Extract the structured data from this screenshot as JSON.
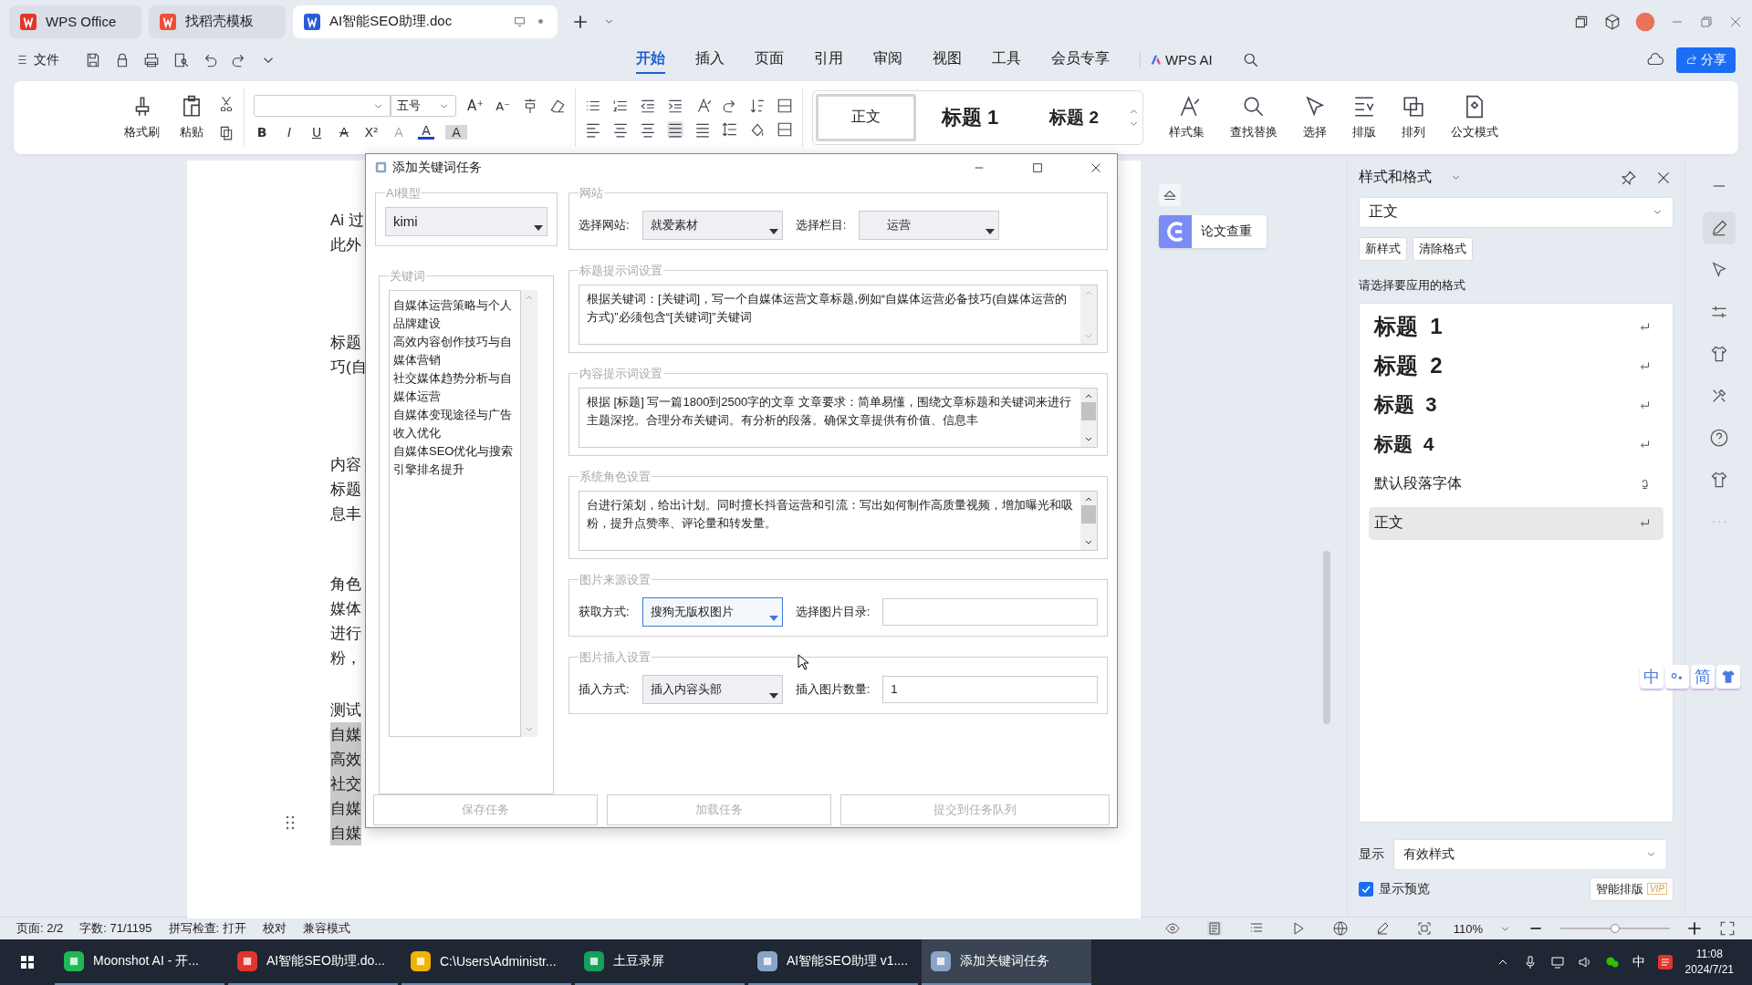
{
  "app_tabs": [
    {
      "label": "WPS Office",
      "kind": "home",
      "selected": false
    },
    {
      "label": "找稻壳模板",
      "kind": "template",
      "selected": false
    },
    {
      "label": "AI智能SEO助理.doc",
      "kind": "doc",
      "selected": true
    }
  ],
  "file_menu": "文件",
  "ribbon_tabs": [
    {
      "label": "开始",
      "selected": true
    },
    {
      "label": "插入",
      "selected": false
    },
    {
      "label": "页面",
      "selected": false
    },
    {
      "label": "引用",
      "selected": false
    },
    {
      "label": "审阅",
      "selected": false
    },
    {
      "label": "视图",
      "selected": false
    },
    {
      "label": "工具",
      "selected": false
    },
    {
      "label": "会员专享",
      "selected": false
    }
  ],
  "wps_ai": "WPS AI",
  "share_button": "分享",
  "ribbon": {
    "format_painter": "格式刷",
    "paste": "粘贴",
    "font_size": "五号",
    "font_top": [
      {
        "label": "A⁺",
        "kind": "grow"
      },
      {
        "label": "A⁻",
        "kind": "shrink"
      }
    ],
    "font_bottom": [
      {
        "label": "B",
        "kind": "bold"
      },
      {
        "label": "I",
        "kind": "italic"
      },
      {
        "label": "U",
        "kind": "underline"
      },
      {
        "label": "A",
        "kind": "strike"
      },
      {
        "label": "X²",
        "kind": "super"
      },
      {
        "label": "A",
        "kind": "effect"
      },
      {
        "label": "A",
        "kind": "color"
      },
      {
        "label": "A",
        "kind": "shade"
      }
    ],
    "style_gallery": [
      {
        "label": "正文",
        "kind": "body",
        "selected": true
      },
      {
        "label": "标题 1",
        "kind": "h1",
        "selected": false
      },
      {
        "label": "标题 2",
        "kind": "h2",
        "selected": false
      }
    ],
    "tools": [
      {
        "label": "样式集",
        "kind": "styleset"
      },
      {
        "label": "查找替换",
        "kind": "find"
      },
      {
        "label": "选择",
        "kind": "select"
      },
      {
        "label": "排版",
        "kind": "layout"
      },
      {
        "label": "排列",
        "kind": "arrange"
      },
      {
        "label": "公文模式",
        "kind": "official"
      }
    ]
  },
  "document": {
    "paragraphs": [
      [
        {
          "text": "Ai 过",
          "highlighted": false
        },
        {
          "text": "此外",
          "highlighted": false
        }
      ],
      [
        {
          "text": "标题",
          "highlighted": false
        },
        {
          "text": "巧(自",
          "highlighted": false
        }
      ],
      [
        {
          "text": "内容",
          "highlighted": false
        },
        {
          "text": "标题",
          "highlighted": false
        },
        {
          "text": "息丰",
          "highlighted": false
        }
      ],
      [
        {
          "text": "角色",
          "highlighted": false
        },
        {
          "text": "媒体",
          "highlighted": false
        },
        {
          "text": "进行",
          "highlighted": false
        },
        {
          "text": "粉，",
          "highlighted": false
        }
      ],
      [
        {
          "text": "测试",
          "highlighted": false
        },
        {
          "text": "自媒",
          "highlighted": true
        },
        {
          "text": "高效",
          "highlighted": true
        },
        {
          "text": "社交",
          "highlighted": true
        },
        {
          "text": "自媒",
          "highlighted": true
        },
        {
          "text": "自媒",
          "highlighted": true
        }
      ]
    ]
  },
  "dialog": {
    "title": "添加关键词任务",
    "model": {
      "legend": "AI模型",
      "value": "kimi"
    },
    "site": {
      "legend": "网站",
      "site_label": "选择网站:",
      "site_value": "就爱素材",
      "column_label": "选择栏目:",
      "column_value": "运营"
    },
    "keywords": {
      "legend": "关键词",
      "items": [
        "自媒体运营策略与个人品牌建设",
        "高效内容创作技巧与自媒体营销",
        "社交媒体趋势分析与自媒体运营",
        "自媒体变现途径与广告收入优化",
        "自媒体SEO优化与搜索引擎排名提升"
      ]
    },
    "prompts": [
      {
        "legend": "标题提示词设置",
        "text": "根据关键词：[关键词]，写一个自媒体运营文章标题,例如“自媒体运营必备技巧(自媒体运营的方式)”必须包含“[关键词]”关键词",
        "scrollable": false
      },
      {
        "legend": "内容提示词设置",
        "text": "根据 [标题] 写一篇1800到2500字的文章 文章要求：简单易懂，围绕文章标题和关键词来进行主题深挖。合理分布关键词。有分析的段落。确保文章提供有价值、信息丰",
        "scrollable": true
      },
      {
        "legend": "系统角色设置",
        "text": "台进行策划，给出计划。同时擅长抖音运营和引流：写出如何制作高质量视频，增加曝光和吸粉，提升点赞率、评论量和转发量。",
        "scrollable": true
      }
    ],
    "image_source": {
      "legend": "图片来源设置",
      "method_label": "获取方式:",
      "method_value": "搜狗无版权图片",
      "dir_label": "选择图片目录:"
    },
    "image_insert": {
      "legend": "图片插入设置",
      "method_label": "插入方式:",
      "method_value": "插入内容头部",
      "count_label": "插入图片数量:",
      "count_value": "1"
    },
    "buttons": [
      {
        "label": "保存任务",
        "disabled": true
      },
      {
        "label": "加载任务",
        "disabled": true
      },
      {
        "label": "提交到任务队列",
        "disabled": true
      }
    ]
  },
  "paper_check": "论文查重",
  "styles_panel": {
    "title": "样式和格式",
    "current": "正文",
    "new_style": "新样式",
    "clear_format": "清除格式",
    "prompt": "请选择要应用的格式",
    "styles": [
      {
        "label": "标题",
        "number": "1",
        "kind": "h1",
        "character_style": false,
        "selected": false
      },
      {
        "label": "标题",
        "number": "2",
        "kind": "h2",
        "character_style": false,
        "selected": false
      },
      {
        "label": "标题",
        "number": "3",
        "kind": "h3",
        "character_style": false,
        "selected": false
      },
      {
        "label": "标题",
        "number": "4",
        "kind": "h4",
        "character_style": false,
        "selected": false
      },
      {
        "label": "默认段落字体",
        "kind": "plain",
        "character_style": true,
        "selected": false
      },
      {
        "label": "正文",
        "kind": "plain",
        "character_style": false,
        "selected": true
      }
    ],
    "show_label": "显示",
    "show_value": "有效样式",
    "preview_label": "显示预览",
    "preview_checked": true,
    "smart_layout": "智能排版",
    "vip": "VIP"
  },
  "ime_toolbar": [
    "中",
    "简"
  ],
  "status_bar": {
    "page": "页面: 2/2",
    "words": "字数: 71/1195",
    "spell": "拼写检查: 打开",
    "proof": "校对",
    "compat": "兼容模式",
    "zoom": "110%",
    "zoom_slider": {
      "level": 0.5
    }
  },
  "taskbar": {
    "items": [
      {
        "label": "Moonshot AI - 开...",
        "kind": "browser",
        "selected": false
      },
      {
        "label": "AI智能SEO助理.do...",
        "kind": "wps",
        "selected": false
      },
      {
        "label": "C:\\Users\\Administr...",
        "kind": "folder",
        "selected": false
      },
      {
        "label": "土豆录屏",
        "kind": "recorder",
        "selected": false
      },
      {
        "label": "AI智能SEO助理 v1....",
        "kind": "app",
        "selected": false
      },
      {
        "label": "添加关键词任务",
        "kind": "app",
        "selected": true
      }
    ],
    "ime": "中",
    "time": "11:08",
    "date": "2024/7/21"
  }
}
